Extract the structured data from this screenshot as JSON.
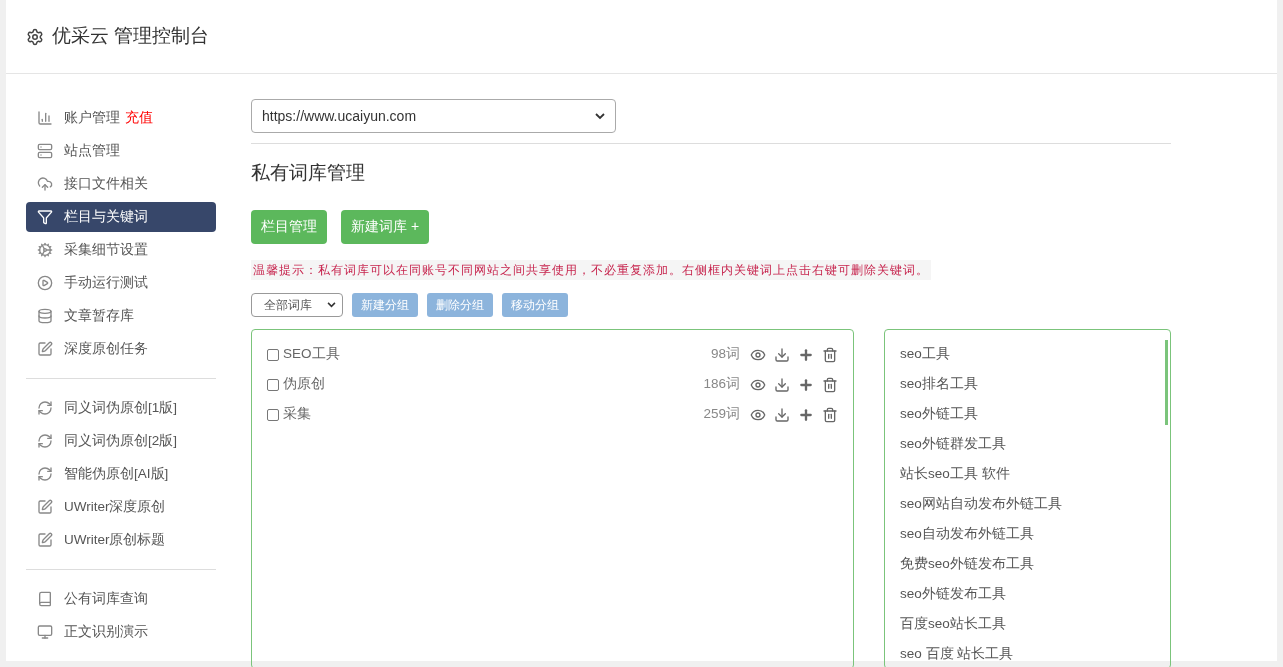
{
  "header": {
    "title": "优采云 管理控制台"
  },
  "sidebar": {
    "groups": [
      {
        "items": [
          {
            "label": "账户管理",
            "badge": "充值",
            "selected": false
          },
          {
            "label": "站点管理",
            "selected": false
          },
          {
            "label": "接口文件相关",
            "selected": false
          },
          {
            "label": "栏目与关键词",
            "selected": true
          },
          {
            "label": "采集细节设置",
            "selected": false
          },
          {
            "label": "手动运行测试",
            "selected": false
          },
          {
            "label": "文章暂存库",
            "selected": false
          },
          {
            "label": "深度原创任务",
            "selected": false
          }
        ]
      },
      {
        "items": [
          {
            "label": "同义词伪原创[1版]",
            "selected": false
          },
          {
            "label": "同义词伪原创[2版]",
            "selected": false
          },
          {
            "label": "智能伪原创[AI版]",
            "selected": false
          },
          {
            "label": "UWriter深度原创",
            "selected": false
          },
          {
            "label": "UWriter原创标题",
            "selected": false
          }
        ]
      },
      {
        "items": [
          {
            "label": "公有词库查询",
            "selected": false
          },
          {
            "label": "正文识别演示",
            "selected": false
          }
        ]
      }
    ]
  },
  "site_select": {
    "value": "https://www.ucaiyun.com"
  },
  "page_title": "私有词库管理",
  "action_buttons": [
    {
      "label": "栏目管理"
    },
    {
      "label": "新建词库 +"
    }
  ],
  "tip": "温馨提示：私有词库可以在同账号不同网站之间共享使用，不必重复添加。右侧框内关键词上点击右键可删除关键词。",
  "group_select": {
    "value": "全部词库"
  },
  "group_buttons": [
    "新建分组",
    "删除分组",
    "移动分组"
  ],
  "libraries": [
    {
      "name": "SEO工具",
      "count": "98词",
      "checked": false
    },
    {
      "name": "伪原创",
      "count": "186词",
      "checked": false
    },
    {
      "name": "采集",
      "count": "259词",
      "checked": false
    }
  ],
  "keywords": [
    "seo工具",
    "seo排名工具",
    "seo外链工具",
    "seo外链群发工具",
    "站长seo工具 软件",
    "seo网站自动发布外链工具",
    "seo自动发布外链工具",
    "免费seo外链发布工具",
    "seo外链发布工具",
    "百度seo站长工具",
    "seo 百度 站长工具"
  ]
}
